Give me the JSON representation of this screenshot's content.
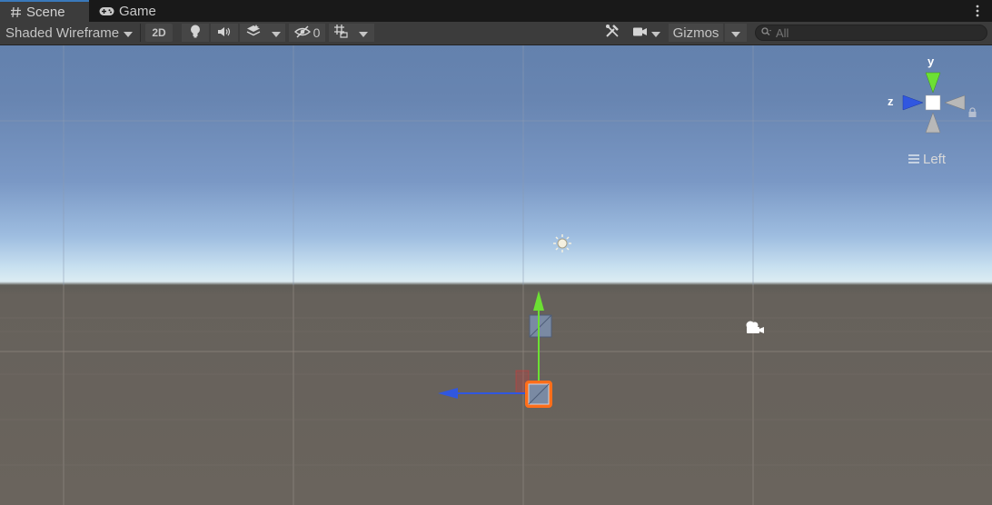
{
  "tabs": {
    "scene_label": "Scene",
    "game_label": "Game"
  },
  "toolbar": {
    "shading_mode": "Shaded Wireframe",
    "btn_2d": "2D",
    "hidden_count": "0",
    "gizmos_label": "Gizmos"
  },
  "search": {
    "placeholder": "All"
  },
  "scene_gizmo": {
    "y_label": "y",
    "z_label": "z",
    "view_label": "Left"
  },
  "colors": {
    "tab_accent": "#3a79bb",
    "axis_x": "#d93636",
    "axis_y": "#6ce033",
    "axis_z": "#3057e0",
    "selection": "#ff6e1a"
  },
  "icons": [
    "hash-icon",
    "gamepad-icon",
    "kebab-menu-icon",
    "dropdown-arrow-icon",
    "lightbulb-icon",
    "speaker-icon",
    "layers-icon",
    "eye-slash-icon",
    "grid-snap-icon",
    "tools-icon",
    "camera-icon",
    "search-icon",
    "lock-icon",
    "hamburger-icon",
    "sun-icon",
    "camera-gizmo-icon"
  ]
}
